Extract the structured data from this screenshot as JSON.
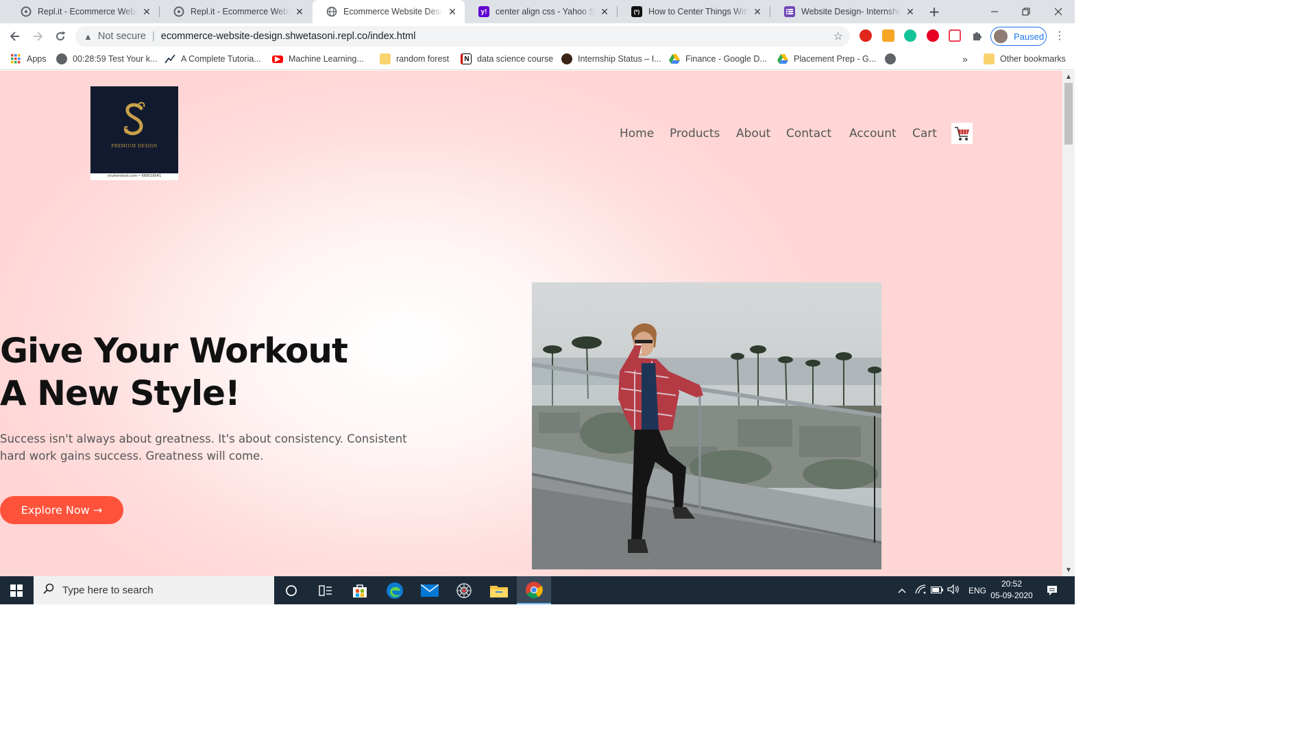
{
  "browser": {
    "tabs": [
      {
        "title": "Repl.it - Ecommerce Website",
        "icon": "replit-icon",
        "active": false
      },
      {
        "title": "Repl.it - Ecommerce Website",
        "icon": "replit-icon",
        "active": false
      },
      {
        "title": "Ecommerce Website Design",
        "icon": "globe-icon",
        "active": true
      },
      {
        "title": "center align css - Yahoo Search",
        "icon": "yahoo-icon",
        "active": false
      },
      {
        "title": "How to Center Things With Style",
        "icon": "css-tricks-icon",
        "active": false
      },
      {
        "title": "Website Design- Internship Program",
        "icon": "forms-icon",
        "active": false
      }
    ],
    "close_glyph": "✕",
    "new_tab_glyph": "+",
    "address": {
      "security_label": "Not secure",
      "url": "ecommerce-website-design.shwetasoni.repl.co/index.html"
    },
    "profile_label": "Paused",
    "bookmarks": [
      {
        "label": "Apps",
        "icon": "apps-grid-icon"
      },
      {
        "label": "00:28:59 Test Your k...",
        "icon": "globe-icon"
      },
      {
        "label": "A Complete Tutoria...",
        "icon": "chart-icon"
      },
      {
        "label": "Machine Learning...",
        "icon": "youtube-icon"
      },
      {
        "label": "random forest",
        "icon": "folder-icon"
      },
      {
        "label": "data science course",
        "icon": "notion-icon"
      },
      {
        "label": "Internship Status – I...",
        "icon": "avatar-icon"
      },
      {
        "label": "Finance - Google D...",
        "icon": "drive-icon"
      },
      {
        "label": "Placement Prep - G...",
        "icon": "drive-icon"
      },
      {
        "label": "",
        "icon": "globe-icon"
      }
    ],
    "bookmarks_overflow": "»",
    "other_bookmarks": "Other bookmarks"
  },
  "page": {
    "logo": {
      "tagline": "PREMIUM DESIGN",
      "credit": "shutterstock.com • 668018041"
    },
    "nav": [
      "Home",
      "Products",
      "About",
      "Contact",
      "Account",
      "Cart"
    ],
    "hero": {
      "title_line1": "Give Your Workout",
      "title_line2": "A New Style!",
      "text": "Success isn't always about greatness. It's about consistency. Consistent hard work gains success. Greatness will come.",
      "button_label": "Explore Now →"
    },
    "colors": {
      "accent": "#ff523b",
      "background": "#ffd6d6",
      "title": "#111111"
    }
  },
  "taskbar": {
    "search_placeholder": "Type here to search",
    "language": "ENG",
    "time": "20:52",
    "date": "05-09-2020"
  }
}
